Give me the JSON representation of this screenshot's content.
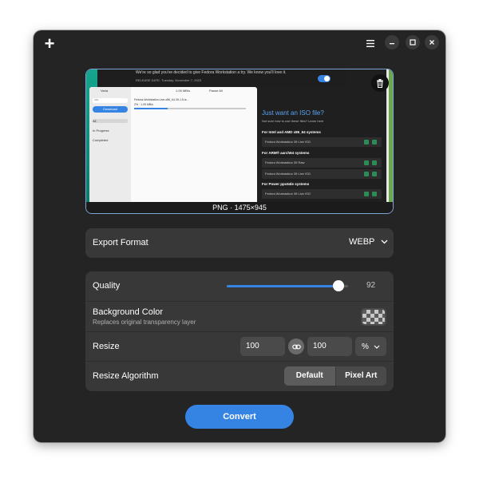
{
  "header": {
    "new_icon": "plus-icon",
    "menu_icon": "hamburger-menu-icon",
    "minimize_icon": "minimize-icon",
    "maximize_icon": "maximize-icon",
    "close_icon": "close-icon"
  },
  "preview": {
    "caption": "PNG · 1475×945",
    "delete_icon": "trash-icon",
    "screenshot": {
      "page_intro": "We're so glad you've decided to give Fedora Workstation a try. We know you'll love it.",
      "release_date": "RELEASE DATE: Tuesday, November 7, 2023",
      "app_title": "Varia",
      "app_speed": "1.09 MB/s",
      "pause_all": "Pause All",
      "download_button": "Download",
      "nav_all": "All",
      "nav_in_progress": "In Progress",
      "nav_completed": "Completed",
      "file_name": "Fedora-Workstation-Live-x86_64-39-1.5.is...",
      "file_progress": "2% · 1.09 MB/s",
      "iso_heading": "Just want an ISO file?",
      "iso_sub": "Not sure how to use these files? Learn here",
      "sections": [
        {
          "title": "For Intel and AMD x86_64 systems",
          "rows": [
            "Fedora Workstation 39  Live ISO"
          ]
        },
        {
          "title": "For ARM® aarch64 systems",
          "rows": [
            "Fedora Workstation 39  Raw",
            "Fedora Workstation 39  Live ISO"
          ]
        },
        {
          "title": "For Power ppc64le systems",
          "rows": [
            "Fedora Workstation 39  Live ISO"
          ]
        }
      ]
    }
  },
  "export": {
    "label": "Export Format",
    "value": "WEBP",
    "chevron_icon": "chevron-down-icon"
  },
  "settings": {
    "quality": {
      "label": "Quality",
      "value": 92,
      "value_text": "92"
    },
    "background": {
      "label": "Background Color",
      "sublabel": "Replaces original transparency layer"
    },
    "resize": {
      "label": "Resize",
      "width": "100",
      "height": "100",
      "unit": "%",
      "link_icon": "link-icon"
    },
    "algorithm": {
      "label": "Resize Algorithm",
      "options": [
        "Default",
        "Pixel Art"
      ],
      "selected": "Default"
    }
  },
  "convert": {
    "label": "Convert"
  },
  "colors": {
    "accent": "#3584e4",
    "window_bg": "#242424",
    "card_bg": "#383838"
  }
}
